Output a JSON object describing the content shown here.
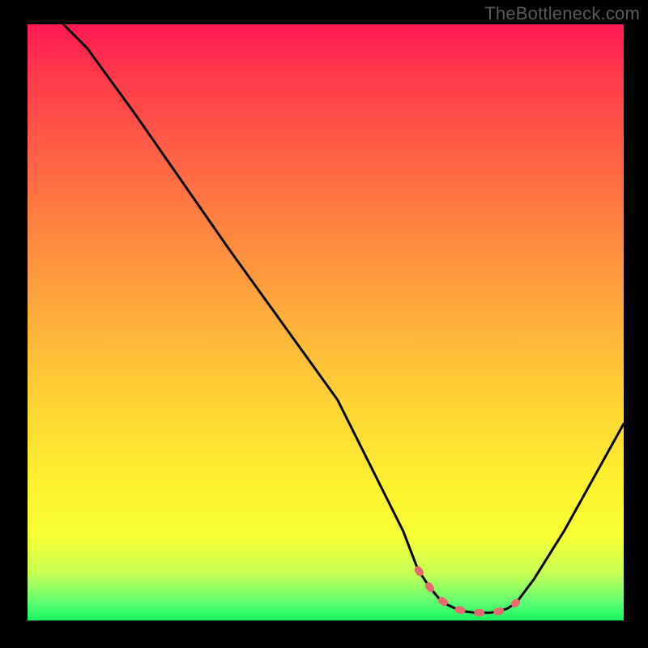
{
  "watermark_text": "TheBottleneck.com",
  "chart_data": {
    "type": "line",
    "title": "",
    "xlabel": "",
    "ylabel": "",
    "xlim": [
      0,
      100
    ],
    "ylim": [
      0,
      100
    ],
    "series": [
      {
        "name": "curve",
        "x": [
          6,
          10,
          18,
          34,
          52,
          63,
          65.5,
          67.5,
          69,
          70.5,
          72,
          73.5,
          75,
          77.5,
          79,
          80.5,
          82,
          85,
          90,
          100
        ],
        "y": [
          100,
          96,
          85,
          62,
          37,
          15,
          8.5,
          5.5,
          3.7,
          2.6,
          1.9,
          1.5,
          1.3,
          1.3,
          1.5,
          2.0,
          3.0,
          7.0,
          15,
          33
        ]
      }
    ],
    "highlight_region": {
      "color": "#e96a6e",
      "x": [
        65.5,
        67.5,
        69,
        70.5,
        72,
        73.5,
        75,
        77.5,
        79,
        80.5,
        82
      ],
      "y": [
        8.5,
        5.5,
        3.7,
        2.6,
        1.9,
        1.5,
        1.3,
        1.3,
        1.5,
        2.0,
        3.0
      ]
    },
    "background_gradient": {
      "top": "#ff1a52",
      "bottom": "#15f55f"
    }
  }
}
